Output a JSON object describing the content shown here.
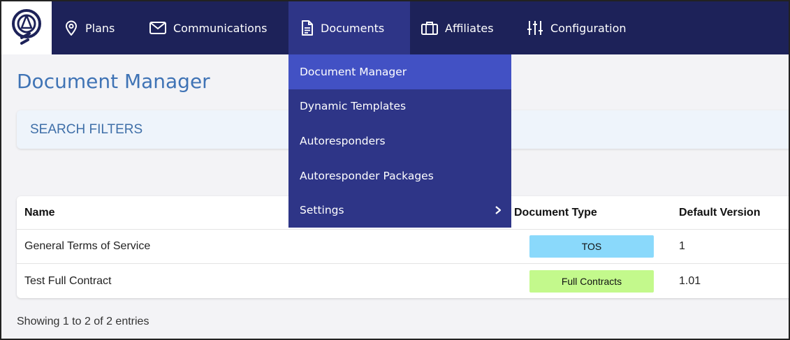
{
  "nav": {
    "items": [
      {
        "label": "Plans",
        "icon": "map-pin-icon"
      },
      {
        "label": "Communications",
        "icon": "mail-icon"
      },
      {
        "label": "Documents",
        "icon": "document-icon"
      },
      {
        "label": "Affiliates",
        "icon": "briefcase-icon"
      },
      {
        "label": "Configuration",
        "icon": "sliders-icon"
      }
    ],
    "active": "Documents"
  },
  "dropdown": {
    "items": [
      {
        "label": "Document Manager"
      },
      {
        "label": "Dynamic Templates"
      },
      {
        "label": "Autoresponders"
      },
      {
        "label": "Autoresponder Packages"
      },
      {
        "label": "Settings"
      }
    ]
  },
  "page": {
    "title": "Document Manager",
    "search_filters": "SEARCH FILTERS"
  },
  "table": {
    "columns": [
      "Name",
      "Document Type",
      "Default Version"
    ],
    "rows": [
      {
        "name": "General Terms of Service",
        "type": "TOS",
        "version": "1"
      },
      {
        "name": "Test Full Contract",
        "type": "Full Contracts",
        "version": "1.01"
      }
    ]
  },
  "footer": {
    "showing": "Showing 1 to 2 of 2 entries"
  },
  "colors": {
    "nav_bg": "#1d2259",
    "dropdown_bg": "#2e3587",
    "dropdown_active": "#4251c4",
    "title": "#3f73b5",
    "badge_tos": "#8ad9fb",
    "badge_full": "#c3f98c"
  }
}
